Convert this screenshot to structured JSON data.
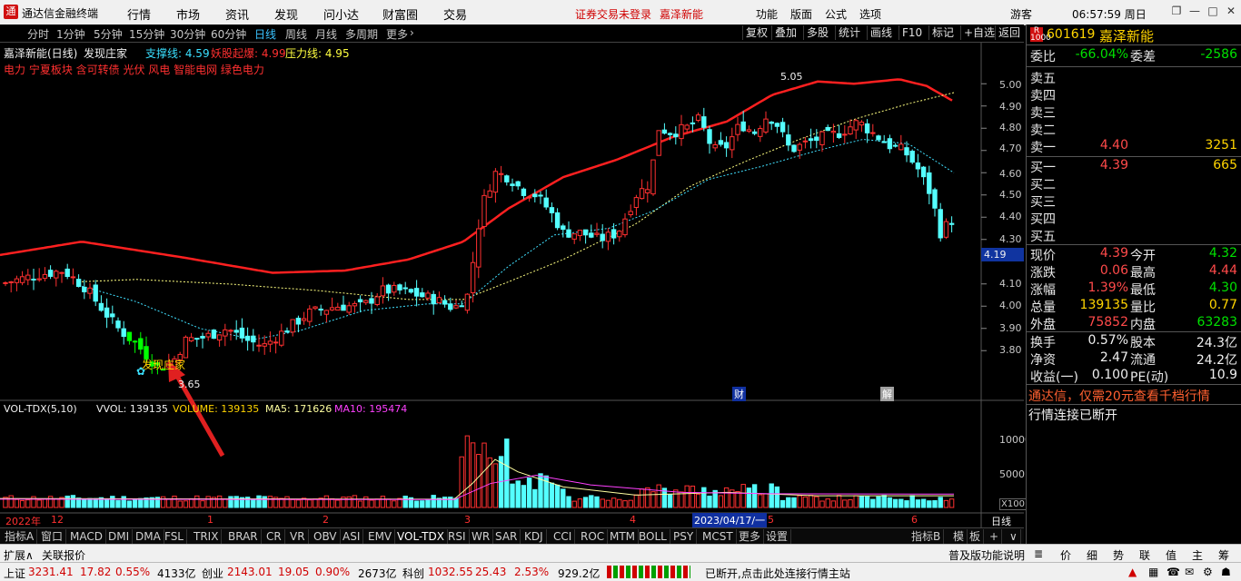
{
  "menubar": {
    "app_title": "通达信金融终端",
    "items": [
      "行情",
      "市场",
      "资讯",
      "发现",
      "问小达",
      "财富圈",
      "交易"
    ],
    "login_notice": "证券交易未登录",
    "stock_short": "嘉泽新能",
    "right_items": [
      "功能",
      "版面",
      "公式",
      "选项"
    ],
    "user": "游客",
    "clock": "06:57:59 周日"
  },
  "periodbar": {
    "items": [
      "分时",
      "1分钟",
      "5分钟",
      "15分钟",
      "30分钟",
      "60分钟",
      "日线",
      "周线",
      "月线",
      "多周期",
      "更多"
    ],
    "active": "日线",
    "right_buttons": [
      "复权",
      "叠加",
      "多股",
      "统计",
      "画线",
      "F10",
      "标记",
      "+自选",
      "返回"
    ]
  },
  "main_chart": {
    "title": "嘉泽新能(日线)",
    "indicator": "发现庄家",
    "support_label": "支撑线: 4.59",
    "monster_label": "妖股起爆: 4.99",
    "pressure_label": "压力线: 4.95",
    "concepts": "电力 宁夏板块 含可转债 光伏 风电 智能电网 绿色电力",
    "high_mark": "5.05",
    "low_mark": "3.65",
    "annotation": "发现庄家",
    "fin_mark": "财",
    "unlock_mark": "解",
    "current_price_tag": "4.19",
    "y_ticks": [
      "5.00",
      "4.90",
      "4.80",
      "4.70",
      "4.60",
      "4.50",
      "4.40",
      "4.30",
      "4.10",
      "4.00",
      "3.90",
      "3.80"
    ]
  },
  "volume_chart": {
    "name": "VOL-TDX(5,10)",
    "vvol": "VVOL: 139135",
    "volume": "VOLUME: 139135",
    "ma5": "MA5: 171626",
    "ma10": "MA10: 195474",
    "y_ticks": [
      "10000",
      "5000"
    ],
    "unit": "X100"
  },
  "time_axis": {
    "labels": [
      "2022年",
      "12",
      "1",
      "2",
      "3",
      "4",
      "2023/04/17/一",
      "5",
      "6"
    ],
    "mode": "日线"
  },
  "tabbar": {
    "items": [
      "指标A",
      "窗口",
      "MACD",
      "DMI",
      "DMA",
      "FSL",
      "TRIX",
      "BRAR",
      "CR",
      "VR",
      "OBV",
      "ASI",
      "EMV",
      "VOL-TDX",
      "RSI",
      "WR",
      "SAR",
      "KDJ",
      "CCI",
      "ROC",
      "MTM",
      "BOLL",
      "PSY",
      "MCST",
      "更多",
      "设置"
    ],
    "right_items": [
      "指标B",
      "模",
      "板"
    ]
  },
  "quote_panel": {
    "code": "601619",
    "name": "嘉泽新能",
    "weibi_label": "委比",
    "weibi_value": "-66.04%",
    "weicha_label": "委差",
    "weicha_value": "-2586",
    "asks": [
      {
        "label": "卖五",
        "price": "",
        "vol": ""
      },
      {
        "label": "卖四",
        "price": "",
        "vol": ""
      },
      {
        "label": "卖三",
        "price": "",
        "vol": ""
      },
      {
        "label": "卖二",
        "price": "",
        "vol": ""
      },
      {
        "label": "卖一",
        "price": "4.40",
        "vol": "3251"
      }
    ],
    "bids": [
      {
        "label": "买一",
        "price": "4.39",
        "vol": "665"
      },
      {
        "label": "买二",
        "price": "",
        "vol": ""
      },
      {
        "label": "买三",
        "price": "",
        "vol": ""
      },
      {
        "label": "买四",
        "price": "",
        "vol": ""
      },
      {
        "label": "买五",
        "price": "",
        "vol": ""
      }
    ],
    "stats": [
      {
        "l1": "现价",
        "v1": "4.39",
        "c1": "red",
        "l2": "今开",
        "v2": "4.32",
        "c2": "green"
      },
      {
        "l1": "涨跌",
        "v1": "0.06",
        "c1": "red",
        "l2": "最高",
        "v2": "4.44",
        "c2": "red"
      },
      {
        "l1": "涨幅",
        "v1": "1.39%",
        "c1": "red",
        "l2": "最低",
        "v2": "4.30",
        "c2": "green"
      },
      {
        "l1": "总量",
        "v1": "139135",
        "c1": "yellow",
        "l2": "量比",
        "v2": "0.77",
        "c2": "yellow"
      },
      {
        "l1": "外盘",
        "v1": "75852",
        "c1": "red",
        "l2": "内盘",
        "v2": "63283",
        "c2": "green"
      }
    ],
    "stats2": [
      {
        "l1": "换手",
        "v1": "0.57%",
        "l2": "股本",
        "v2": "24.3亿"
      },
      {
        "l1": "净资",
        "v1": "2.47",
        "l2": "流通",
        "v2": "24.2亿"
      },
      {
        "l1": "收益(一)",
        "v1": "0.100",
        "l2": "PE(动)",
        "v2": "10.9"
      }
    ],
    "ad_text": "通达信，仅需20元查看千档行情",
    "disconnected": "行情连接已断开"
  },
  "extbar": {
    "left": [
      "扩展∧",
      "关联报价"
    ],
    "right_label": "普及版功能说明",
    "right_icons": [
      "≣",
      "价",
      "细",
      "势",
      "联",
      "值",
      "主",
      "筹"
    ]
  },
  "statusbar": {
    "sh_label": "上证",
    "sh_val": "3231.41",
    "sh_chg": "17.82",
    "sh_pct": "0.55%",
    "sh_amt": "4133亿",
    "cy_label": "创业",
    "cy_val": "2143.01",
    "cy_chg": "19.05",
    "cy_pct": "0.90%",
    "cy_amt": "2673亿",
    "kc_label": "科创",
    "kc_val": "1032.55",
    "kc_chg": "25.43",
    "kc_pct": "2.53%",
    "kc_amt": "929.2亿",
    "notice": "已断开,点击此处连接行情主站"
  },
  "chart_data": {
    "type": "candlestick",
    "title": "嘉泽新能(日线)",
    "ylim": [
      3.65,
      5.05
    ],
    "y_ticks": [
      5.0,
      4.9,
      4.8,
      4.7,
      4.6,
      4.5,
      4.4,
      4.3,
      4.1,
      4.0,
      3.9,
      3.8
    ],
    "high": 5.05,
    "low": 3.65,
    "last_close": 4.39,
    "series": [
      {
        "name": "支撑线",
        "last_value": 4.59
      },
      {
        "name": "妖股起爆",
        "last_value": 4.99
      },
      {
        "name": "压力线",
        "last_value": 4.95
      }
    ],
    "volume": {
      "name": "VOL-TDX(5,10)",
      "last": 139135,
      "ma5": 171626,
      "ma10": 195474,
      "y_ticks": [
        10000,
        5000
      ]
    }
  }
}
